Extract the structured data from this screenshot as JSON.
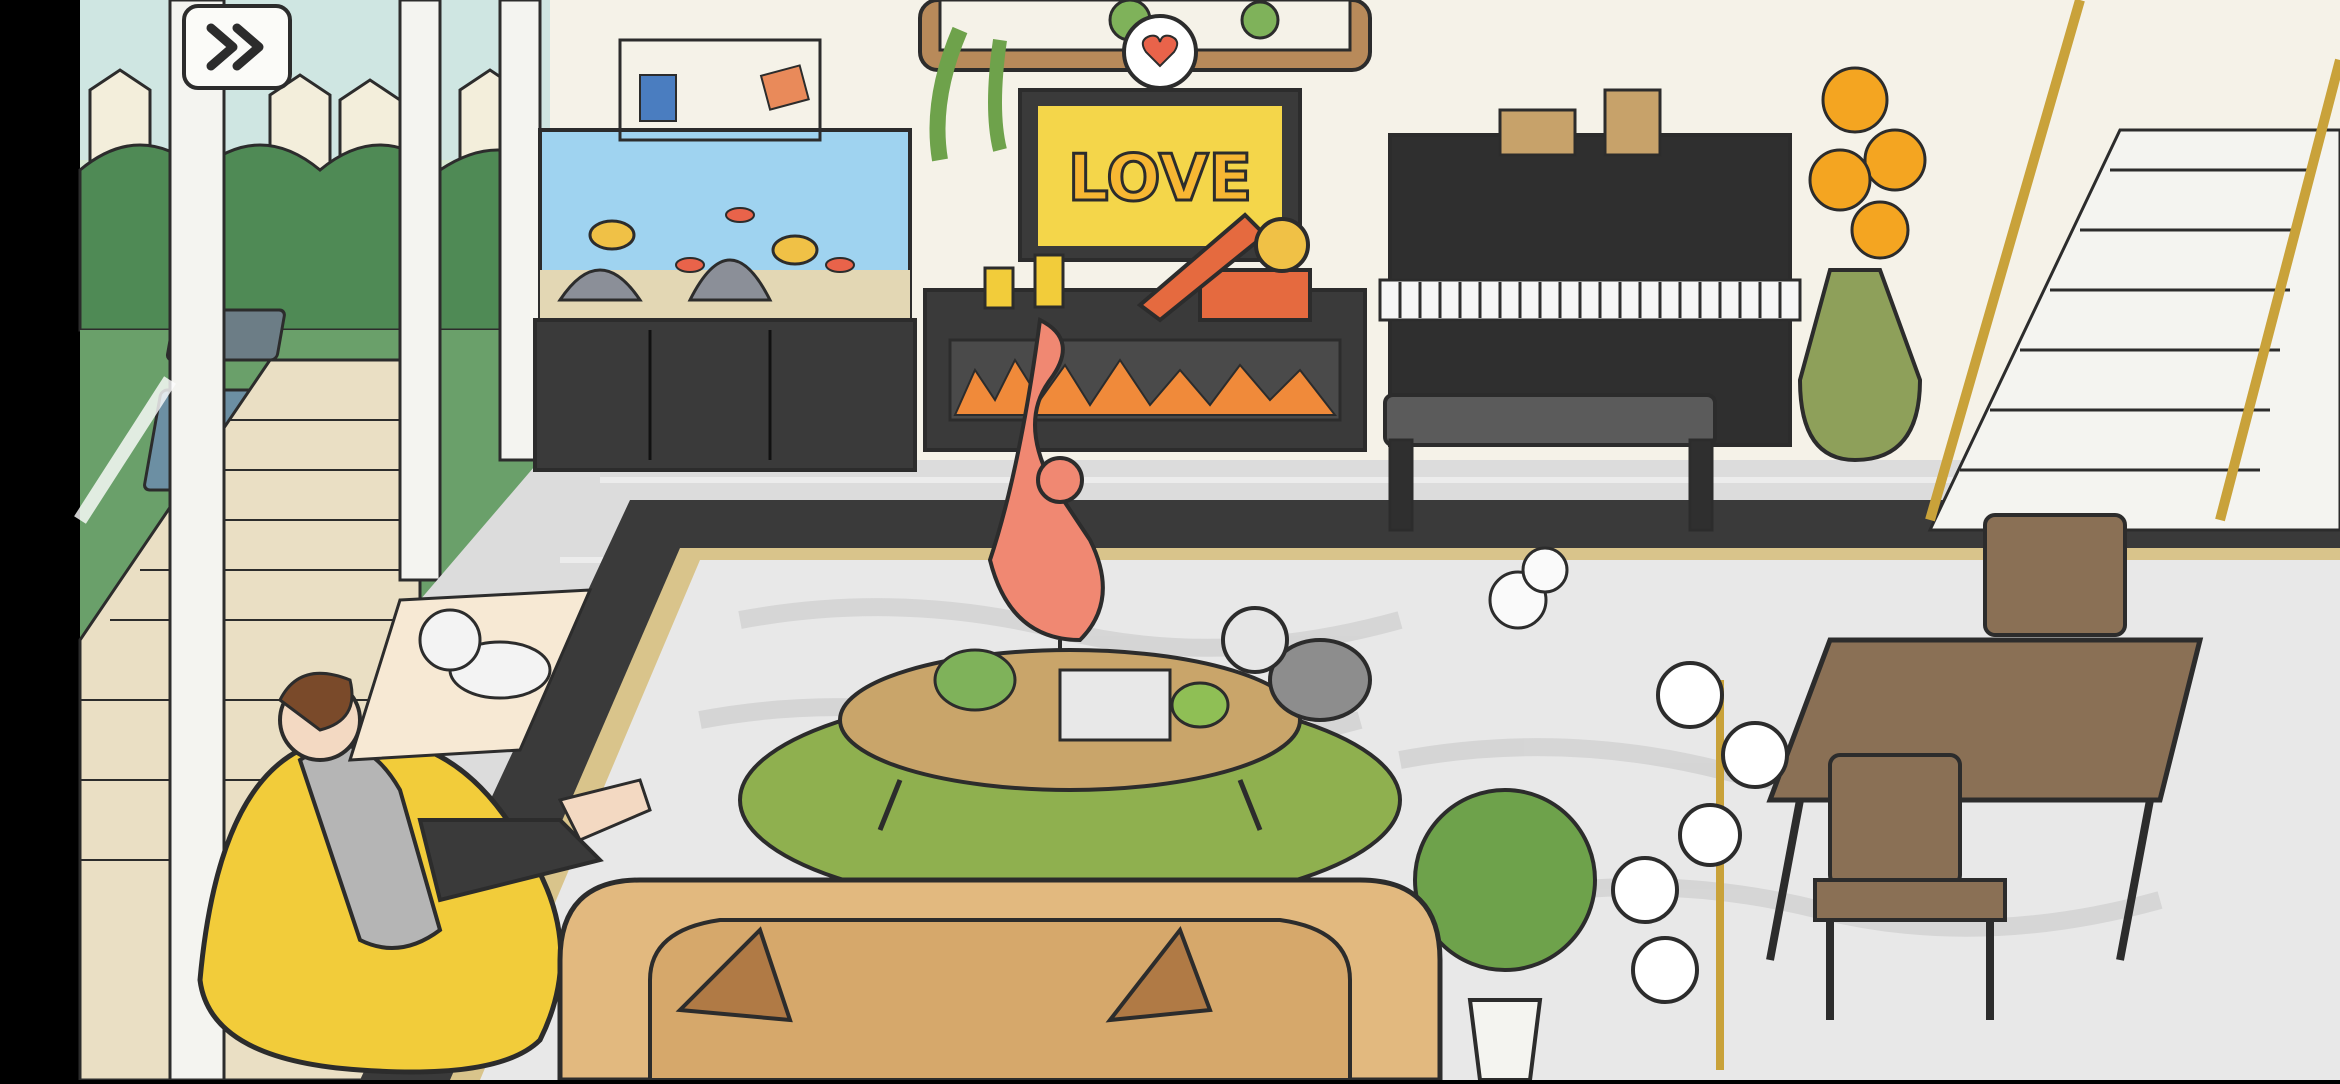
{
  "game": {
    "title": "",
    "scene": "living-room"
  },
  "controls": {
    "fast_forward_icon": "fast-forward-icon"
  },
  "decor": {
    "tv_screen_text": "LOVE",
    "speech_bubble_icon": "heart-icon"
  },
  "colors": {
    "outline": "#2c2c2c",
    "wall": "#f5f2e8",
    "floor": "#dcdcdc",
    "rug_border": "#d9c48b",
    "rug_dark": "#3a3a3a",
    "table_wood": "#c9a56a",
    "beanbag": "#f2cc3a",
    "flamingo": "#f08872",
    "plant_green": "#6ea24b",
    "sofa": "#e2b97f",
    "fireplace": "#f08a3a",
    "aquarium": "#9fd3f0",
    "piano": "#2f2f2f",
    "sunflower": "#f4a521"
  }
}
